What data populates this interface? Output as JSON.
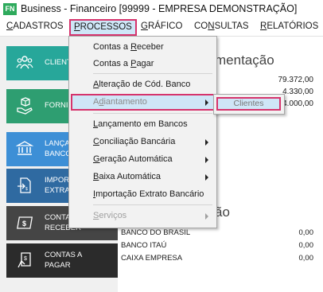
{
  "window": {
    "logo": "FN",
    "title": "Business - Financeiro  [99999 - EMPRESA DEMONSTRAÇÃO]"
  },
  "menubar": [
    {
      "pre": "",
      "u": "C",
      "post": "ADASTROS"
    },
    {
      "pre": "",
      "u": "P",
      "post": "ROCESSOS"
    },
    {
      "pre": "",
      "u": "G",
      "post": "RÁFICO"
    },
    {
      "pre": "CO",
      "u": "N",
      "post": "SULTAS"
    },
    {
      "pre": "",
      "u": "R",
      "post": "ELATÓRIOS"
    }
  ],
  "sidebar": [
    {
      "label": "CLIENT",
      "icon": "people-icon",
      "color": "#27a79a"
    },
    {
      "label": "FORNI",
      "icon": "box-hand-icon",
      "color": "#2e9e71"
    },
    {
      "label": "LANÇA\nBANCO",
      "icon": "bank-icon",
      "color": "#3d8fd6"
    },
    {
      "label": "IMPOR\nEXTRA",
      "icon": "file-import-icon",
      "color": "#2f6aa1"
    },
    {
      "label": "CONTA\nRECEBER",
      "icon": "receive-icon",
      "color": "#454545"
    },
    {
      "label": "CONTAS A\nPAGAR",
      "icon": "pay-icon",
      "color": "#2b2b2b"
    }
  ],
  "main": {
    "title": "mentação",
    "amounts": [
      "79.372,00",
      "4.330,00",
      "4.000,00"
    ],
    "section_title": "ão",
    "banks": [
      {
        "name": "BANCO DO BRASIL",
        "value": "0,00"
      },
      {
        "name": "BANCO ITAÚ",
        "value": "0,00"
      },
      {
        "name": "CAIXA EMPRESA",
        "value": "0,00"
      }
    ]
  },
  "dropdown": [
    {
      "pre": "Contas a ",
      "u": "R",
      "post": "eceber",
      "arrow": false,
      "disabled": false
    },
    {
      "pre": "Contas a ",
      "u": "P",
      "post": "agar",
      "arrow": false,
      "disabled": false
    },
    {
      "pre": "",
      "u": "A",
      "post": "lteração de Cód. Banco",
      "arrow": false,
      "disabled": false
    },
    {
      "pre": "A",
      "u": "d",
      "post": "iantamento",
      "arrow": true,
      "disabled": false
    },
    {
      "pre": "",
      "u": "L",
      "post": "ançamento em Bancos",
      "arrow": false,
      "disabled": false
    },
    {
      "pre": "",
      "u": "C",
      "post": "onciliação Bancária",
      "arrow": true,
      "disabled": false
    },
    {
      "pre": "",
      "u": "G",
      "post": "eração Automática",
      "arrow": true,
      "disabled": false
    },
    {
      "pre": "",
      "u": "B",
      "post": "aixa Automática",
      "arrow": true,
      "disabled": false
    },
    {
      "pre": "",
      "u": "I",
      "post": "mportação Extrato Bancário",
      "arrow": false,
      "disabled": false
    },
    {
      "pre": "",
      "u": "S",
      "post": "erviços",
      "arrow": true,
      "disabled": true
    }
  ],
  "submenu": {
    "label": "Clientes"
  },
  "colors": {
    "highlight_border": "#d6336c",
    "highlight_fill": "#cfe6f7",
    "logo": "#2eaa5c"
  }
}
